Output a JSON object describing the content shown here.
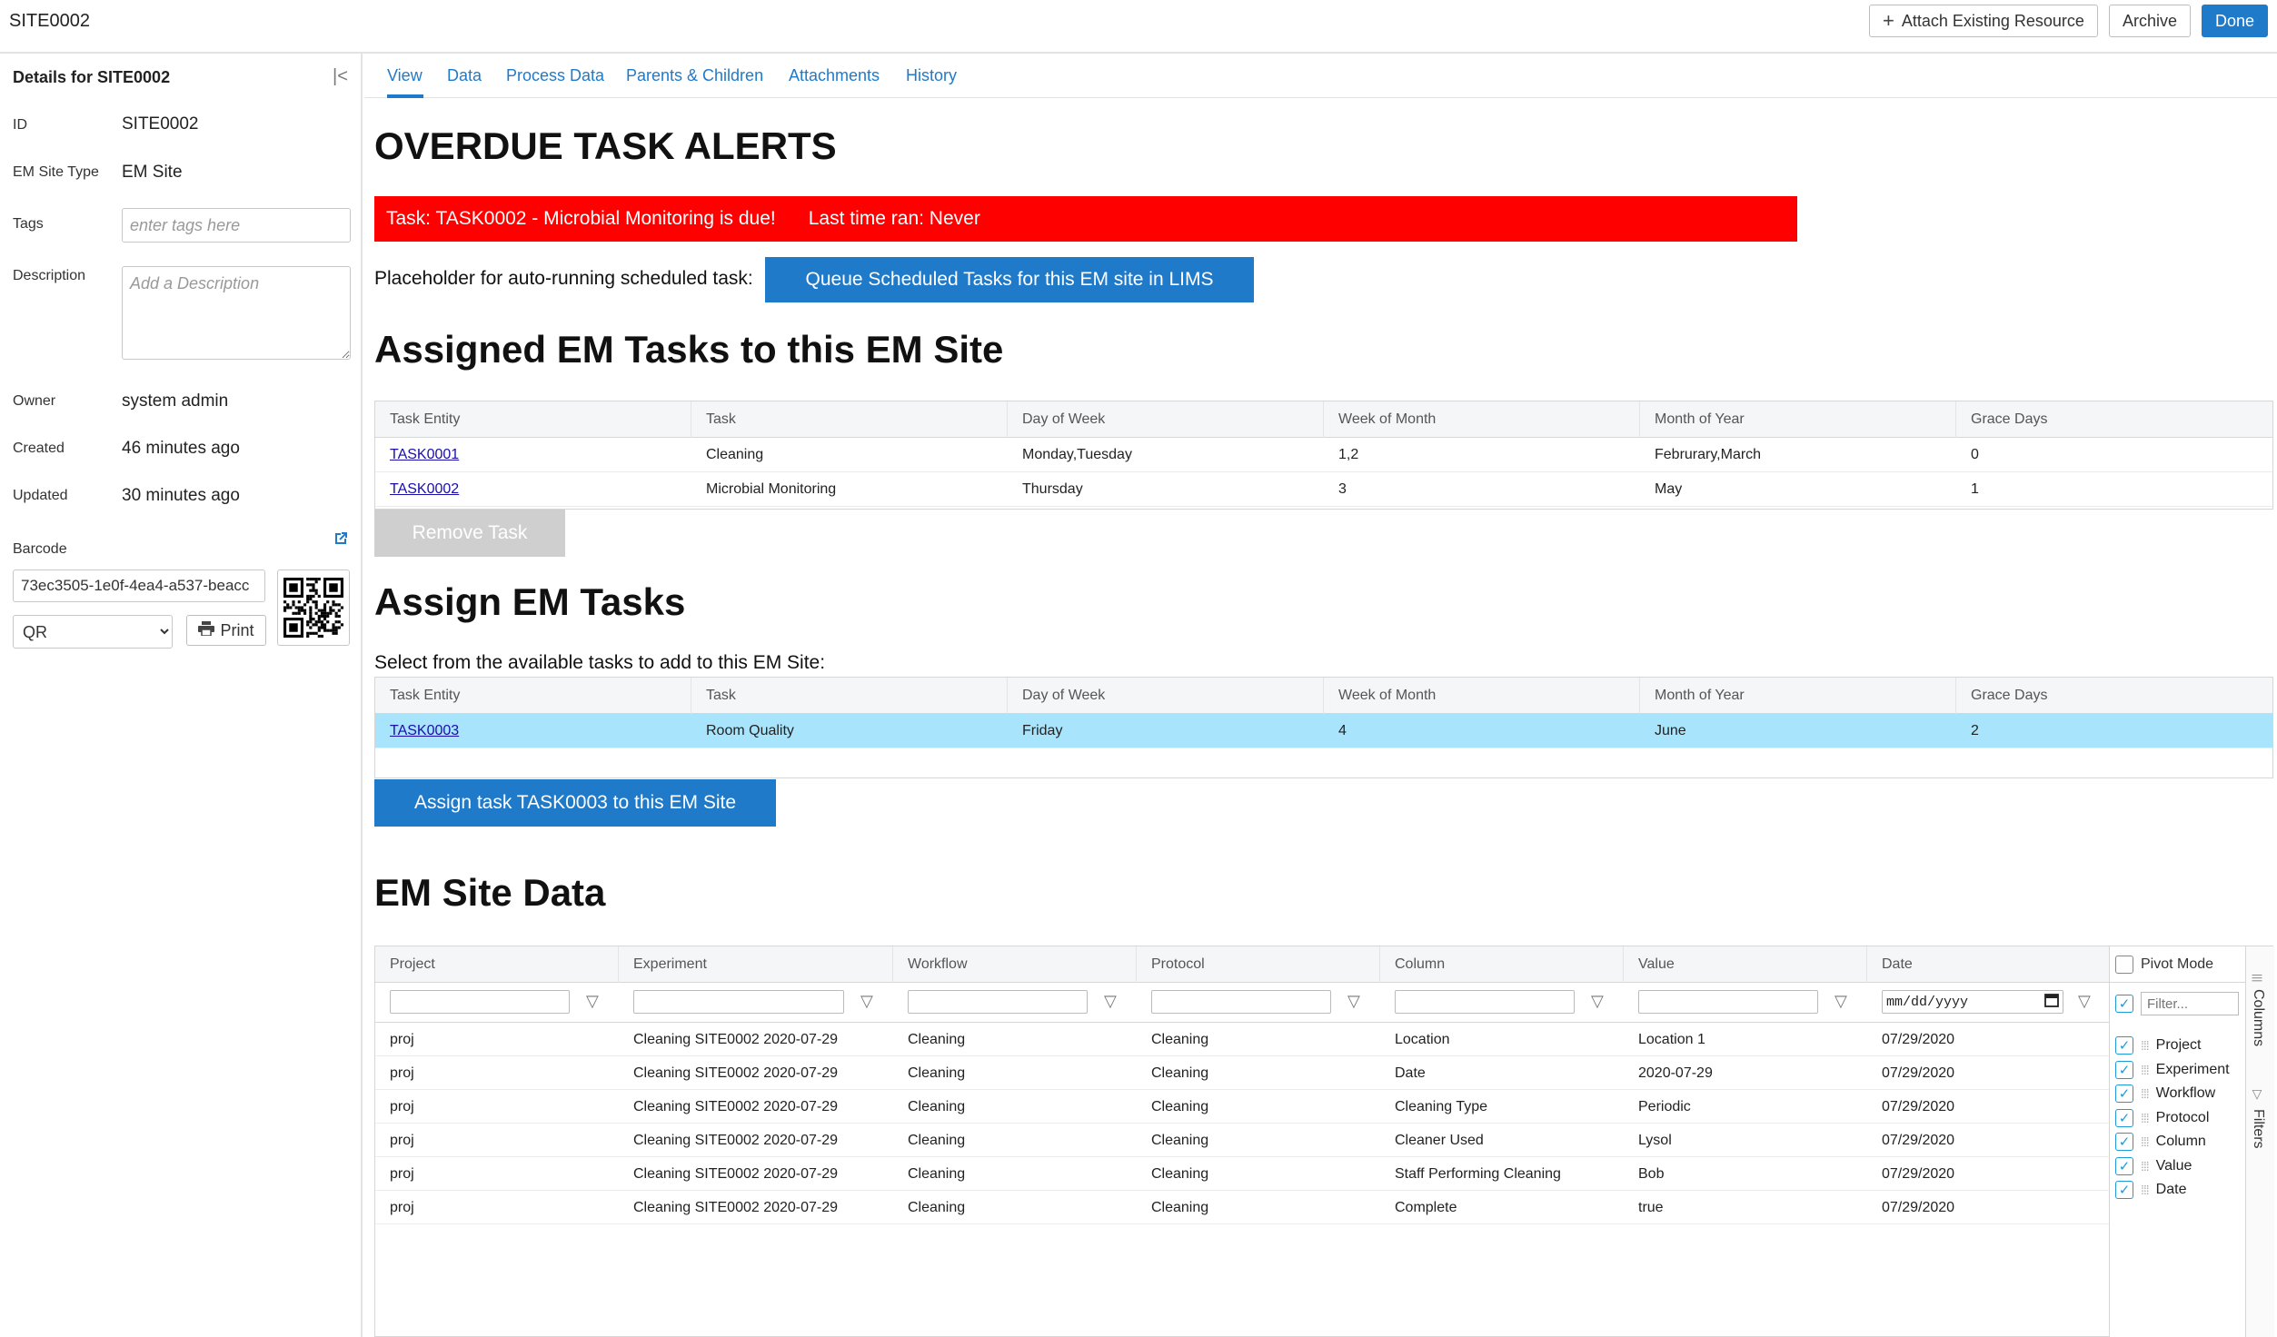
{
  "topbar": {
    "title": "SITE0002",
    "attach_label": "Attach Existing Resource",
    "archive_label": "Archive",
    "done_label": "Done"
  },
  "sidebar": {
    "title": "Details for SITE0002",
    "id_label": "ID",
    "id_value": "SITE0002",
    "type_label": "EM Site Type",
    "type_value": "EM Site",
    "tags_label": "Tags",
    "tags_placeholder": "enter tags here",
    "description_label": "Description",
    "description_placeholder": "Add a Description",
    "owner_label": "Owner",
    "owner_value": "system admin",
    "created_label": "Created",
    "created_value": "46 minutes ago",
    "updated_label": "Updated",
    "updated_value": "30 minutes ago",
    "barcode_label": "Barcode",
    "barcode_value": "73ec3505-1e0f-4ea4-a537-beacc",
    "barcode_format": "QR",
    "print_label": "Print"
  },
  "tabs": [
    "View",
    "Data",
    "Process Data",
    "Parents & Children",
    "Attachments",
    "History"
  ],
  "alerts": {
    "heading": "OVERDUE TASK ALERTS",
    "task_text": "Task: TASK0002 - Microbial Monitoring is due!",
    "last_ran_text": "Last time ran: Never"
  },
  "scheduler": {
    "label": "Placeholder for auto-running scheduled task:",
    "button": "Queue Scheduled Tasks for this EM site in LIMS"
  },
  "assigned": {
    "heading": "Assigned EM Tasks to this EM Site",
    "columns": [
      "Task Entity",
      "Task",
      "Day of Week",
      "Week of Month",
      "Month of Year",
      "Grace Days"
    ],
    "rows": [
      [
        "TASK0001",
        "Cleaning",
        "Monday,Tuesday",
        "1,2",
        "Februrary,March",
        "0"
      ],
      [
        "TASK0002",
        "Microbial Monitoring",
        "Thursday",
        "3",
        "May",
        "1"
      ]
    ],
    "remove_button": "Remove Task"
  },
  "assign": {
    "heading": "Assign EM Tasks",
    "instruction": "Select from the available tasks to add to this EM Site:",
    "columns": [
      "Task Entity",
      "Task",
      "Day of Week",
      "Week of Month",
      "Month of Year",
      "Grace Days"
    ],
    "rows": [
      [
        "TASK0003",
        "Room Quality",
        "Friday",
        "4",
        "June",
        "2"
      ]
    ],
    "assign_button": "Assign task TASK0003 to this EM Site"
  },
  "site_data": {
    "heading": "EM Site Data",
    "columns": [
      "Project",
      "Experiment",
      "Workflow",
      "Protocol",
      "Column",
      "Value",
      "Date"
    ],
    "date_placeholder": "mm/dd/yyyy",
    "rows": [
      [
        "proj",
        "Cleaning SITE0002 2020-07-29",
        "Cleaning",
        "Cleaning",
        "Location",
        "Location 1",
        "07/29/2020"
      ],
      [
        "proj",
        "Cleaning SITE0002 2020-07-29",
        "Cleaning",
        "Cleaning",
        "Date",
        "2020-07-29",
        "07/29/2020"
      ],
      [
        "proj",
        "Cleaning SITE0002 2020-07-29",
        "Cleaning",
        "Cleaning",
        "Cleaning Type",
        "Periodic",
        "07/29/2020"
      ],
      [
        "proj",
        "Cleaning SITE0002 2020-07-29",
        "Cleaning",
        "Cleaning",
        "Cleaner Used",
        "Lysol",
        "07/29/2020"
      ],
      [
        "proj",
        "Cleaning SITE0002 2020-07-29",
        "Cleaning",
        "Cleaning",
        "Staff Performing Cleaning",
        "Bob",
        "07/29/2020"
      ],
      [
        "proj",
        "Cleaning SITE0002 2020-07-29",
        "Cleaning",
        "Cleaning",
        "Complete",
        "true",
        "07/29/2020"
      ]
    ],
    "tool_panel": {
      "pivot_label": "Pivot Mode",
      "filter_placeholder": "Filter...",
      "columns": [
        "Project",
        "Experiment",
        "Workflow",
        "Protocol",
        "Column",
        "Value",
        "Date"
      ],
      "side_tabs": [
        "Columns",
        "Filters"
      ]
    }
  },
  "colors": {
    "accent": "#1f7ac9",
    "alert": "#ff0000",
    "selected_row": "#a8e4fb"
  }
}
